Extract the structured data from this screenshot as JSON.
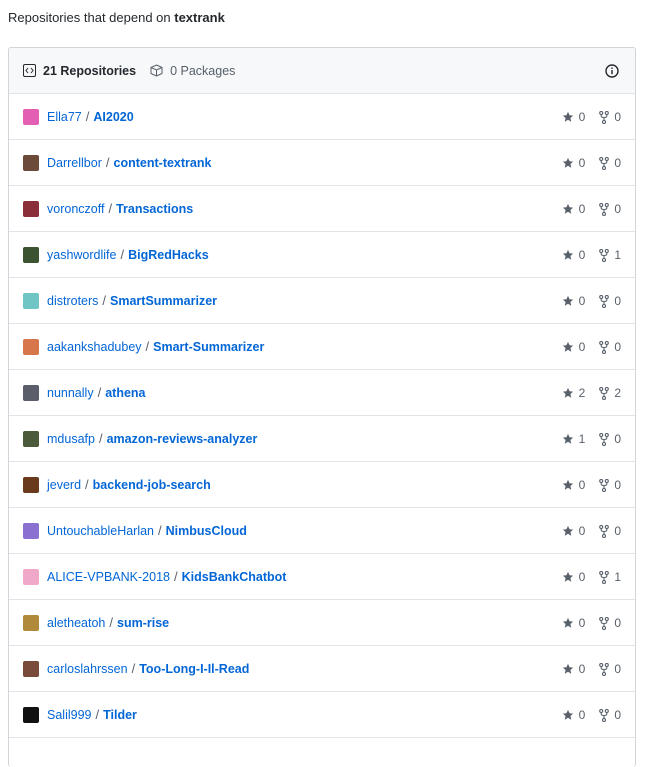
{
  "heading": {
    "prefix": "Repositories that depend on",
    "package": "textrank"
  },
  "tabs": [
    {
      "label": "21 Repositories",
      "icon": "code-icon",
      "selected": true
    },
    {
      "label": "0 Packages",
      "icon": "package-icon",
      "selected": false
    }
  ],
  "rows": [
    {
      "owner": "Ella77",
      "repo": "AI2020",
      "stars": "0",
      "forks": "0",
      "avatar_color": "#e35fb4"
    },
    {
      "owner": "Darrellbor",
      "repo": "content-textrank",
      "stars": "0",
      "forks": "0",
      "avatar_color": "#6b4a3a"
    },
    {
      "owner": "voronczoff",
      "repo": "Transactions",
      "stars": "0",
      "forks": "0",
      "avatar_color": "#8a2f3a"
    },
    {
      "owner": "yashwordlife",
      "repo": "BigRedHacks",
      "stars": "0",
      "forks": "1",
      "avatar_color": "#3b5330"
    },
    {
      "owner": "distroters",
      "repo": "SmartSummarizer",
      "stars": "0",
      "forks": "0",
      "avatar_color": "#6fc4c4"
    },
    {
      "owner": "aakankshadubey",
      "repo": "Smart-Summarizer",
      "stars": "0",
      "forks": "0",
      "avatar_color": "#d6764a"
    },
    {
      "owner": "nunnally",
      "repo": "athena",
      "stars": "2",
      "forks": "2",
      "avatar_color": "#5a5d6a"
    },
    {
      "owner": "mdusafp",
      "repo": "amazon-reviews-analyzer",
      "stars": "1",
      "forks": "0",
      "avatar_color": "#4a5a3a"
    },
    {
      "owner": "jeverd",
      "repo": "backend-job-search",
      "stars": "0",
      "forks": "0",
      "avatar_color": "#6a3a1c"
    },
    {
      "owner": "UntouchableHarlan",
      "repo": "NimbusCloud",
      "stars": "0",
      "forks": "0",
      "avatar_color": "#8a70d0"
    },
    {
      "owner": "ALICE-VPBANK-2018",
      "repo": "KidsBankChatbot",
      "stars": "0",
      "forks": "1",
      "avatar_color": "#f0a8c8"
    },
    {
      "owner": "aletheatoh",
      "repo": "sum-rise",
      "stars": "0",
      "forks": "0",
      "avatar_color": "#b08a3a"
    },
    {
      "owner": "carloslahrssen",
      "repo": "Too-Long-I-Il-Read",
      "stars": "0",
      "forks": "0",
      "avatar_color": "#7a4a3a"
    },
    {
      "owner": "Salil999",
      "repo": "Tilder",
      "stars": "0",
      "forks": "0",
      "avatar_color": "#111111"
    }
  ]
}
